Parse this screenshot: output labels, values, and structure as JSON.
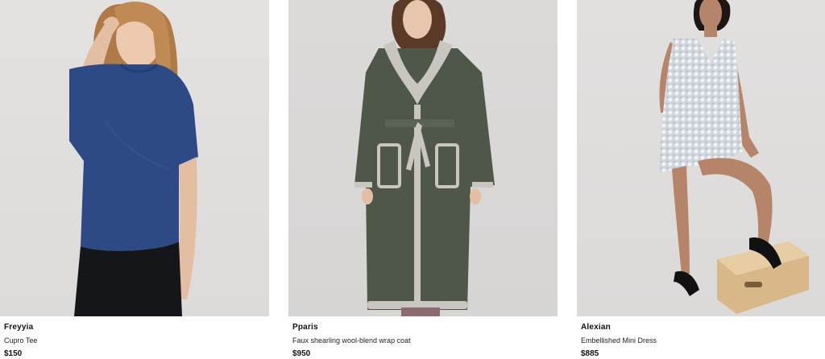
{
  "products": [
    {
      "name": "Freyyia",
      "description": "Cupro Tee",
      "price": "$150",
      "image_alt": "Model wearing blue cupro tee"
    },
    {
      "name": "Pparis",
      "description": "Faux shearling wool-blend wrap coat",
      "price": "$950",
      "image_alt": "Model wearing khaki wrap coat with shearling trim"
    },
    {
      "name": "Alexian",
      "description": "Embellished Mini Dress",
      "price": "$885",
      "image_alt": "Model wearing silver embellished mini dress"
    }
  ],
  "colors": {
    "tee_blue": "#2e4a86",
    "coat_khaki": "#4f5749",
    "shearling": "#c9c6c0",
    "dress_silver": "#d6dbe0"
  }
}
